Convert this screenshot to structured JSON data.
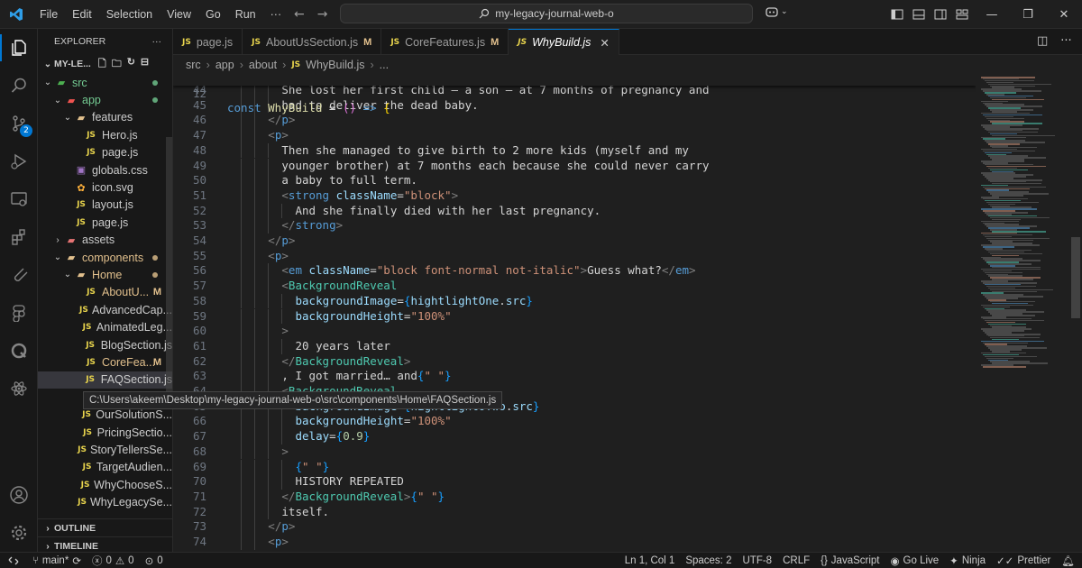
{
  "menu": [
    "File",
    "Edit",
    "Selection",
    "View",
    "Go",
    "Run",
    "···"
  ],
  "search_text": "my-legacy-journal-web-o",
  "tabs": [
    {
      "label": "page.js",
      "modified": ""
    },
    {
      "label": "AboutUsSection.js",
      "modified": "M"
    },
    {
      "label": "CoreFeatures.js",
      "modified": "M"
    },
    {
      "label": "WhyBuild.js",
      "modified": ""
    }
  ],
  "breadcrumb": [
    "src",
    "app",
    "about",
    "WhyBuild.js",
    "..."
  ],
  "sidebar": {
    "title": "EXPLORER",
    "project": "MY-LE...",
    "outline": "OUTLINE",
    "timeline": "TIMELINE",
    "tree": [
      {
        "label": "src",
        "depth": 1,
        "kind": "folder-src",
        "open": true,
        "dot": true
      },
      {
        "label": "app",
        "depth": 2,
        "kind": "folder-app",
        "open": true,
        "dot": true
      },
      {
        "label": "features",
        "depth": 3,
        "kind": "folder",
        "open": true
      },
      {
        "label": "Hero.js",
        "depth": 4,
        "kind": "js"
      },
      {
        "label": "page.js",
        "depth": 4,
        "kind": "js"
      },
      {
        "label": "globals.css",
        "depth": 3,
        "kind": "css"
      },
      {
        "label": "icon.svg",
        "depth": 3,
        "kind": "svg"
      },
      {
        "label": "layout.js",
        "depth": 3,
        "kind": "js"
      },
      {
        "label": "page.js",
        "depth": 3,
        "kind": "js"
      },
      {
        "label": "assets",
        "depth": 2,
        "kind": "folder-assets",
        "open": false
      },
      {
        "label": "components",
        "depth": 2,
        "kind": "folder",
        "open": true,
        "dot": true,
        "color": "yellow"
      },
      {
        "label": "Home",
        "depth": 3,
        "kind": "folder",
        "open": true,
        "dot": true,
        "color": "yellow"
      },
      {
        "label": "AboutU...",
        "depth": 4,
        "kind": "js",
        "mod": "M",
        "color": "yellow"
      },
      {
        "label": "AdvancedCap...",
        "depth": 4,
        "kind": "js"
      },
      {
        "label": "AnimatedLeg...",
        "depth": 4,
        "kind": "js"
      },
      {
        "label": "BlogSection.js",
        "depth": 4,
        "kind": "js"
      },
      {
        "label": "CoreFea...",
        "depth": 4,
        "kind": "js",
        "mod": "M",
        "color": "yellow"
      },
      {
        "label": "FAQSection.js",
        "depth": 4,
        "kind": "js",
        "selected": true
      },
      {
        "label": "",
        "depth": 4,
        "kind": "js"
      },
      {
        "label": "OurSolutionS...",
        "depth": 4,
        "kind": "js"
      },
      {
        "label": "PricingSectio...",
        "depth": 4,
        "kind": "js"
      },
      {
        "label": "StoryTellersSe...",
        "depth": 4,
        "kind": "js"
      },
      {
        "label": "TargetAudien...",
        "depth": 4,
        "kind": "js"
      },
      {
        "label": "WhyChooseS...",
        "depth": 4,
        "kind": "js"
      },
      {
        "label": "WhyLegacySe...",
        "depth": 4,
        "kind": "js"
      }
    ]
  },
  "tooltip": "C:\\Users\\akeem\\Desktop\\my-legacy-journal-web-o\\src\\components\\Home\\FAQSection.js",
  "sticky_line": {
    "num": "12",
    "text": "const WhyBuild = () => {"
  },
  "code_lines": [
    {
      "num": "44",
      "indent": 4,
      "parts": [
        [
          "txt",
          "She lost her first child — a son — at 7 months of pregnancy and"
        ]
      ]
    },
    {
      "num": "45",
      "indent": 4,
      "parts": [
        [
          "txt",
          "had to deliver the dead baby."
        ]
      ]
    },
    {
      "num": "46",
      "indent": 3,
      "parts": [
        [
          "brk",
          "</"
        ],
        [
          "kw",
          "p"
        ],
        [
          "brk",
          ">"
        ]
      ]
    },
    {
      "num": "47",
      "indent": 3,
      "parts": [
        [
          "brk",
          "<"
        ],
        [
          "kw",
          "p"
        ],
        [
          "brk",
          ">"
        ]
      ]
    },
    {
      "num": "48",
      "indent": 4,
      "parts": [
        [
          "txt",
          "Then she managed to give birth to 2 more kids (myself and my"
        ]
      ]
    },
    {
      "num": "49",
      "indent": 4,
      "parts": [
        [
          "txt",
          "younger brother) at 7 months each because she could never carry"
        ]
      ]
    },
    {
      "num": "50",
      "indent": 4,
      "parts": [
        [
          "txt",
          "a baby to full term."
        ]
      ]
    },
    {
      "num": "51",
      "indent": 4,
      "parts": [
        [
          "brk",
          "<"
        ],
        [
          "kw",
          "strong"
        ],
        [
          "txt",
          " "
        ],
        [
          "attr",
          "className"
        ],
        [
          "punc",
          "="
        ],
        [
          "str",
          "\"block\""
        ],
        [
          "brk",
          ">"
        ]
      ]
    },
    {
      "num": "52",
      "indent": 5,
      "parts": [
        [
          "txt",
          "And she finally died with her last pregnancy."
        ]
      ]
    },
    {
      "num": "53",
      "indent": 4,
      "parts": [
        [
          "brk",
          "</"
        ],
        [
          "kw",
          "strong"
        ],
        [
          "brk",
          ">"
        ]
      ]
    },
    {
      "num": "54",
      "indent": 3,
      "parts": [
        [
          "brk",
          "</"
        ],
        [
          "kw",
          "p"
        ],
        [
          "brk",
          ">"
        ]
      ]
    },
    {
      "num": "55",
      "indent": 3,
      "parts": [
        [
          "brk",
          "<"
        ],
        [
          "kw",
          "p"
        ],
        [
          "brk",
          ">"
        ]
      ]
    },
    {
      "num": "56",
      "indent": 4,
      "parts": [
        [
          "brk",
          "<"
        ],
        [
          "kw",
          "em"
        ],
        [
          "txt",
          " "
        ],
        [
          "attr",
          "className"
        ],
        [
          "punc",
          "="
        ],
        [
          "str",
          "\"block font-normal not-italic\""
        ],
        [
          "brk",
          ">"
        ],
        [
          "txt",
          "Guess what?"
        ],
        [
          "brk",
          "</"
        ],
        [
          "kw",
          "em"
        ],
        [
          "brk",
          ">"
        ]
      ]
    },
    {
      "num": "57",
      "indent": 4,
      "parts": [
        [
          "brk",
          "<"
        ],
        [
          "tag",
          "BackgroundReveal"
        ]
      ]
    },
    {
      "num": "58",
      "indent": 5,
      "parts": [
        [
          "attr",
          "backgroundImage"
        ],
        [
          "punc",
          "="
        ],
        [
          "br-b",
          "{"
        ],
        [
          "var",
          "hightlightOne"
        ],
        [
          "punc",
          "."
        ],
        [
          "var",
          "src"
        ],
        [
          "br-b",
          "}"
        ]
      ]
    },
    {
      "num": "59",
      "indent": 5,
      "parts": [
        [
          "attr",
          "backgroundHeight"
        ],
        [
          "punc",
          "="
        ],
        [
          "str",
          "\"100%\""
        ]
      ]
    },
    {
      "num": "60",
      "indent": 4,
      "parts": [
        [
          "brk",
          ">"
        ]
      ]
    },
    {
      "num": "61",
      "indent": 5,
      "parts": [
        [
          "txt",
          "20 years later"
        ]
      ]
    },
    {
      "num": "62",
      "indent": 4,
      "parts": [
        [
          "brk",
          "</"
        ],
        [
          "tag",
          "BackgroundReveal"
        ],
        [
          "brk",
          ">"
        ]
      ]
    },
    {
      "num": "63",
      "indent": 4,
      "parts": [
        [
          "txt",
          ", I got married… and"
        ],
        [
          "br-b",
          "{"
        ],
        [
          "str",
          "\" \""
        ],
        [
          "br-b",
          "}"
        ]
      ]
    },
    {
      "num": "64",
      "indent": 4,
      "parts": [
        [
          "brk",
          "<"
        ],
        [
          "tag",
          "BackgroundReveal"
        ]
      ]
    },
    {
      "num": "65",
      "indent": 5,
      "parts": [
        [
          "attr",
          "backgroundImage"
        ],
        [
          "punc",
          "="
        ],
        [
          "br-b",
          "{"
        ],
        [
          "var",
          "hightlightOTwo"
        ],
        [
          "punc",
          "."
        ],
        [
          "var",
          "src"
        ],
        [
          "br-b",
          "}"
        ]
      ]
    },
    {
      "num": "66",
      "indent": 5,
      "parts": [
        [
          "attr",
          "backgroundHeight"
        ],
        [
          "punc",
          "="
        ],
        [
          "str",
          "\"100%\""
        ]
      ]
    },
    {
      "num": "67",
      "indent": 5,
      "parts": [
        [
          "attr",
          "delay"
        ],
        [
          "punc",
          "="
        ],
        [
          "br-b",
          "{"
        ],
        [
          "num",
          "0.9"
        ],
        [
          "br-b",
          "}"
        ]
      ]
    },
    {
      "num": "68",
      "indent": 4,
      "parts": [
        [
          "brk",
          ">"
        ]
      ]
    },
    {
      "num": "69",
      "indent": 5,
      "parts": [
        [
          "br-b",
          "{"
        ],
        [
          "str",
          "\" \""
        ],
        [
          "br-b",
          "}"
        ]
      ]
    },
    {
      "num": "70",
      "indent": 5,
      "parts": [
        [
          "txt",
          "HISTORY REPEATED"
        ]
      ]
    },
    {
      "num": "71",
      "indent": 4,
      "parts": [
        [
          "brk",
          "</"
        ],
        [
          "tag",
          "BackgroundReveal"
        ],
        [
          "brk",
          ">"
        ],
        [
          "br-b",
          "{"
        ],
        [
          "str",
          "\" \""
        ],
        [
          "br-b",
          "}"
        ]
      ]
    },
    {
      "num": "72",
      "indent": 4,
      "parts": [
        [
          "txt",
          "itself."
        ]
      ]
    },
    {
      "num": "73",
      "indent": 3,
      "parts": [
        [
          "brk",
          "</"
        ],
        [
          "kw",
          "p"
        ],
        [
          "brk",
          ">"
        ]
      ]
    },
    {
      "num": "74",
      "indent": 3,
      "parts": [
        [
          "brk",
          "<"
        ],
        [
          "kw",
          "p"
        ],
        [
          "brk",
          ">"
        ]
      ]
    }
  ],
  "status": {
    "branch": "main*",
    "errors": "0",
    "warnings": "0",
    "info": "0",
    "position": "Ln 1, Col 1",
    "spaces": "Spaces: 2",
    "encoding": "UTF-8",
    "eol": "CRLF",
    "language": "JavaScript",
    "golive": "Go Live",
    "ninja": "Ninja",
    "prettier": "Prettier"
  },
  "colors": {
    "accent": "#0078d4",
    "bg": "#1f1f1f",
    "sidebar_bg": "#181818",
    "modified": "#e2c08d",
    "untracked": "#73c991"
  }
}
